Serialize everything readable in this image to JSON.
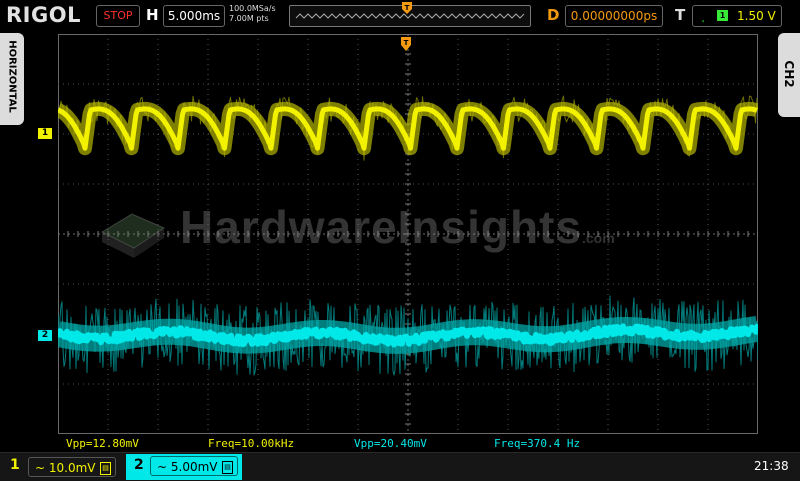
{
  "brand": "RIGOL",
  "run_state": "STOP",
  "horizontal": {
    "label": "H",
    "timebase": "5.000ms"
  },
  "acquisition": {
    "sample_rate": "100.0MSa/s",
    "points": "7.00M pts"
  },
  "delay": {
    "label": "D",
    "value": "0.00000000ps"
  },
  "trigger": {
    "label": "T",
    "source": "1",
    "level": "1.50 V",
    "edge_icon": "rising-edge-icon"
  },
  "side_tabs": {
    "left": "HORIZONTAL",
    "right": "CH2"
  },
  "watermark": {
    "main": "HardwareInsights",
    "suffix": ".com"
  },
  "channels": [
    {
      "id": "1",
      "scale": "10.0mV",
      "color": "#f2f200",
      "coupling_icon": "ac-coupling-icon"
    },
    {
      "id": "2",
      "scale": "5.00mV",
      "color": "#00e8e8",
      "coupling_icon": "ac-coupling-icon"
    }
  ],
  "measurements": [
    {
      "text": "Vpp=12.80mV",
      "color": "#f2f200"
    },
    {
      "text": "Freq=10.00kHz",
      "color": "#f2f200"
    },
    {
      "text": "Vpp=20.40mV",
      "color": "#00e8e8"
    },
    {
      "text": "Freq=370.4 Hz",
      "color": "#00e8e8"
    }
  ],
  "clock": "21:38",
  "colors": {
    "ch1": "#f2f200",
    "ch2": "#00e8e8",
    "delay": "#f39a12",
    "stop": "#ff3030"
  }
}
